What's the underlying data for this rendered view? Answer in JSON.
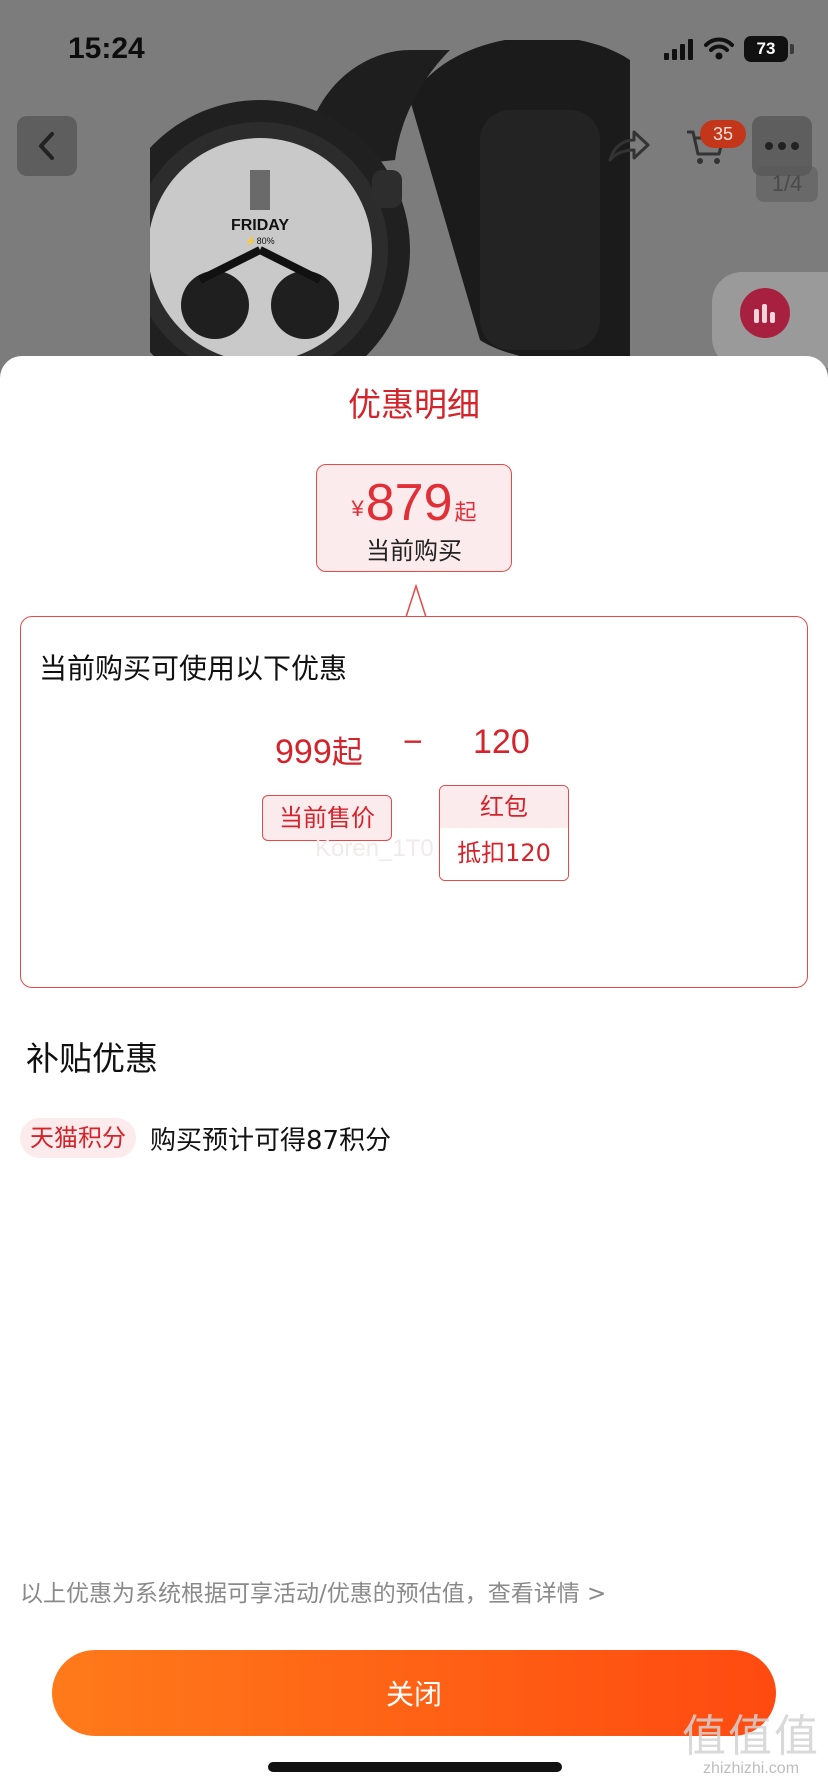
{
  "status_bar": {
    "time": "15:24",
    "battery": "73"
  },
  "product_header": {
    "cart_count": "35",
    "image_indicator": "1/4"
  },
  "watch_face": {
    "day": "FRIDAY",
    "charge": "⚡80%"
  },
  "sheet": {
    "title": "优惠明细",
    "current_price": {
      "symbol": "¥",
      "amount": "879",
      "suffix": "起",
      "caption": "当前购买"
    },
    "detail": {
      "heading": "当前购买可使用以下优惠",
      "original_amount": "999",
      "original_suffix": "起",
      "operator": "−",
      "discount_amount": "120",
      "current_price_tag": "当前售价",
      "hongbao_title": "红包",
      "hongbao_desc": "抵扣120",
      "watermark": "Koren_1T0"
    },
    "subsidy": {
      "title": "补贴优惠",
      "points_tag": "天猫积分",
      "points_text": "购买预计可得87积分"
    },
    "footer_note": "以上优惠为系统根据可享活动/优惠的预估值，查看详情 >",
    "close_label": "关闭"
  },
  "site_watermark": {
    "logo": "值值值",
    "domain": "zhizhizhi.com"
  },
  "colors": {
    "accent": "#d4232a",
    "button_start": "#ff7a1a",
    "button_end": "#ff4a10"
  }
}
